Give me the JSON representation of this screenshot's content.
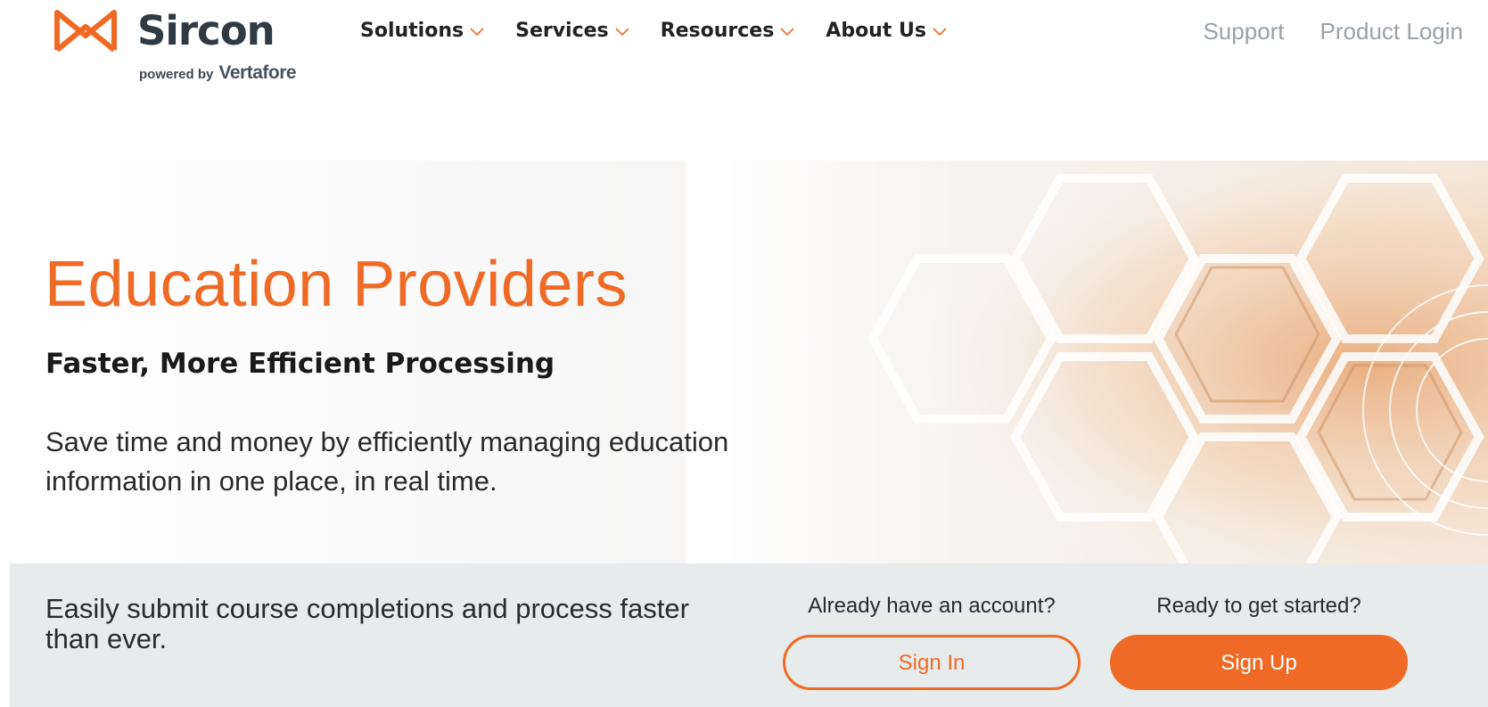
{
  "brand": {
    "name": "Sircon",
    "powered_by": "powered by",
    "parent": "Vertafore",
    "accent_color": "#ef6a25",
    "logo_icon": "sircon-logo-icon"
  },
  "nav": {
    "items": [
      {
        "label": "Solutions",
        "icon": "chevron-down-icon"
      },
      {
        "label": "Services",
        "icon": "chevron-down-icon"
      },
      {
        "label": "Resources",
        "icon": "chevron-down-icon"
      },
      {
        "label": "About Us",
        "icon": "chevron-down-icon"
      }
    ],
    "utility": {
      "support": "Support",
      "product_login": "Product Login"
    }
  },
  "hero": {
    "title": "Education Providers",
    "subtitle": "Faster, More Efficient Processing",
    "description": "Save time and money by efficiently managing education information in one place, in real time."
  },
  "cta_band": {
    "text": "Easily submit course completions and process faster than ever.",
    "signin": {
      "label": "Already have an account?",
      "button": "Sign In"
    },
    "signup": {
      "label": "Ready to get started?",
      "button": "Sign Up"
    }
  }
}
